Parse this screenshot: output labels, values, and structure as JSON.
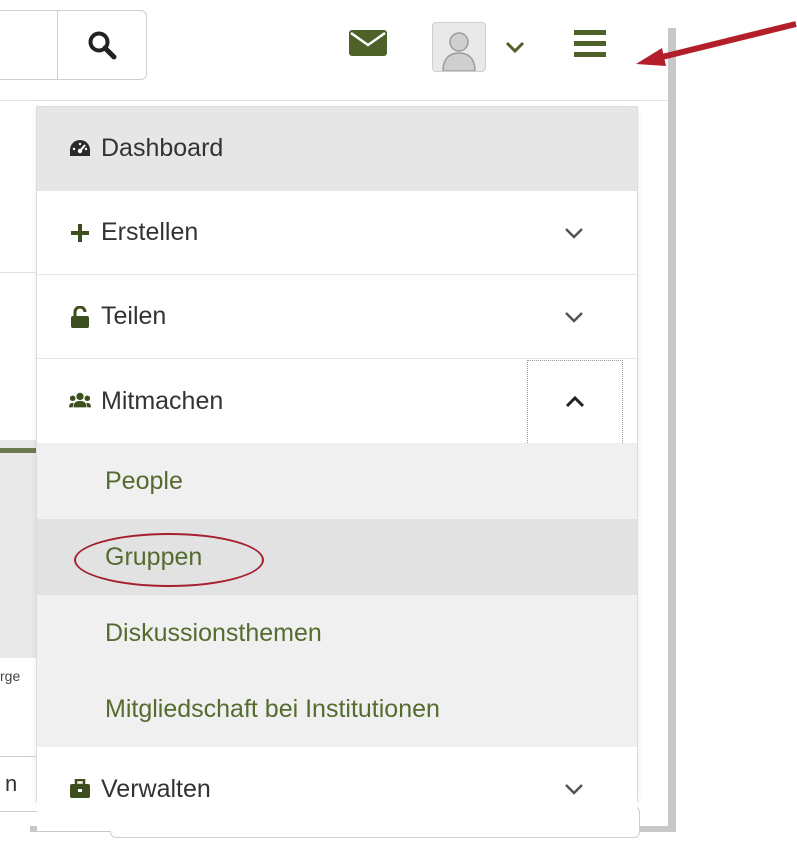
{
  "header": {
    "search_icon": "search-icon",
    "mail_icon": "envelope-icon",
    "user_icon": "user-silhouette-icon",
    "menu_icon": "hamburger-menu-icon",
    "accent_color": "#4d6129"
  },
  "menu": {
    "items": [
      {
        "label": "Dashboard",
        "icon": "dashboard-gauge-icon"
      },
      {
        "label": "Erstellen",
        "icon": "plus-icon",
        "toggle": "chevron-down-icon"
      },
      {
        "label": "Teilen",
        "icon": "unlock-icon",
        "toggle": "chevron-down-icon"
      },
      {
        "label": "Mitmachen",
        "icon": "users-icon",
        "toggle": "chevron-up-icon",
        "expanded": true
      },
      {
        "label": "Verwalten",
        "icon": "briefcase-icon",
        "toggle": "chevron-down-icon"
      }
    ],
    "submenu": [
      "People",
      "Gruppen",
      "Diskussionsthemen",
      "Mitgliedschaft bei Institutionen"
    ],
    "highlighted": "Gruppen"
  },
  "background": {
    "fragment_text": "rge",
    "input_fragment": "n"
  },
  "annotation": {
    "arrow_color": "#b21f2b",
    "circle_color": "#a4202e"
  }
}
